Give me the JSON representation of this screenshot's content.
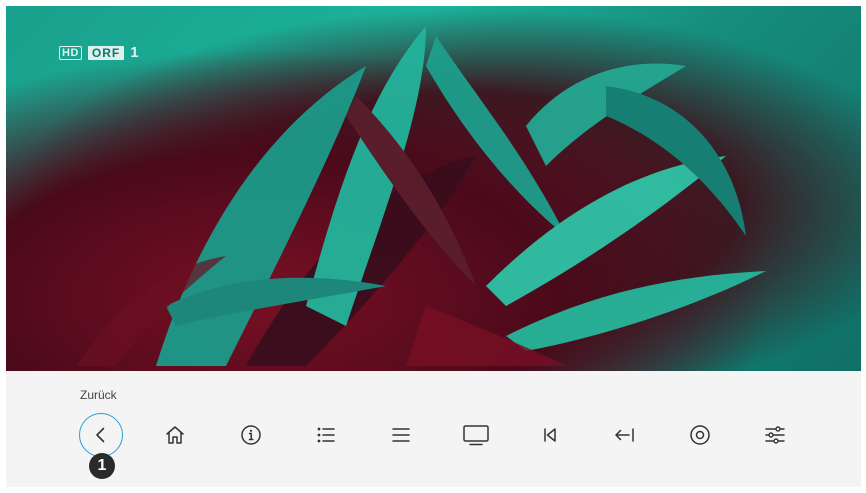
{
  "channel": {
    "hd_label": "HD",
    "name": "ORF",
    "number": "1"
  },
  "menu": {
    "focused_label": "Zurück",
    "items": [
      {
        "icon": "chevron-left-icon",
        "label": "Zurück",
        "focused": true
      },
      {
        "icon": "home-icon"
      },
      {
        "icon": "info-icon"
      },
      {
        "icon": "list-icon"
      },
      {
        "icon": "menu-icon"
      },
      {
        "icon": "tv-icon"
      },
      {
        "icon": "skip-back-icon"
      },
      {
        "icon": "arrow-left-bar-icon"
      },
      {
        "icon": "record-icon"
      },
      {
        "icon": "settings-sliders-icon"
      }
    ]
  },
  "annotation": {
    "step_number": "1"
  },
  "colors": {
    "focus_ring": "#2b9bd6",
    "menu_background": "#f4f4f4",
    "icon": "#333333"
  }
}
